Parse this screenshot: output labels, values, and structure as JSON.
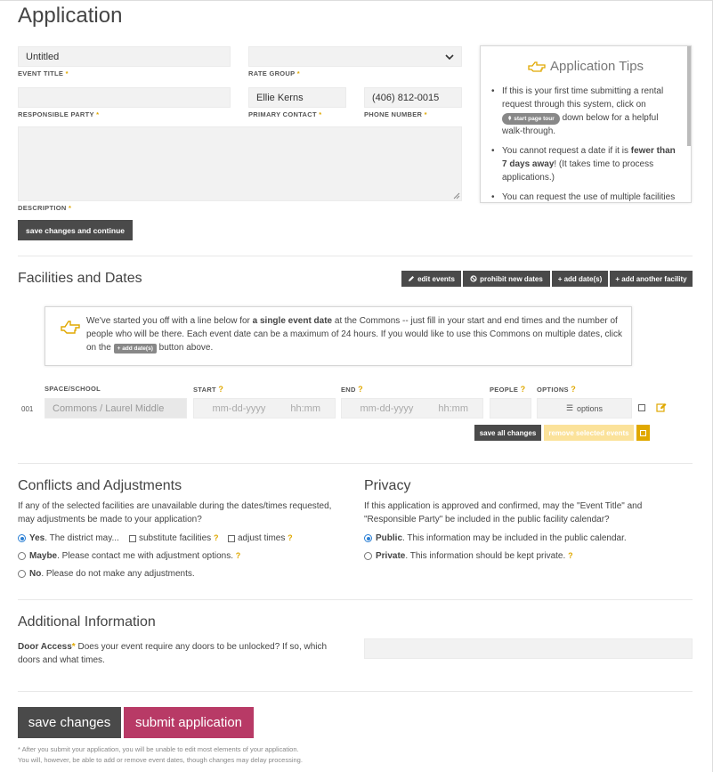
{
  "page": {
    "title": "Application"
  },
  "form": {
    "event_title": {
      "value": "Untitled",
      "label": "EVENT TITLE"
    },
    "rate_group": {
      "value": "",
      "label": "RATE GROUP"
    },
    "responsible_party": {
      "value": "",
      "label": "RESPONSIBLE PARTY"
    },
    "primary_contact": {
      "value": "Ellie Kerns",
      "label": "PRIMARY CONTACT"
    },
    "phone": {
      "value": "(406) 812-0015",
      "label": "PHONE NUMBER"
    },
    "description": {
      "label": "DESCRIPTION"
    },
    "save_continue": "save changes and continue"
  },
  "tips": {
    "title": "Application Tips",
    "t1_a": "If this is your first time submitting a rental request through this system, click on",
    "t1_badge": "start page tour",
    "t1_b": "down below for a helpful walk-through.",
    "t2_a": "You cannot request a date if it is",
    "t2_bold": "fewer than 7 days away",
    "t2_b": "! (It takes time to process applications.)",
    "t3": "You can request the use of multiple facilities"
  },
  "facilities": {
    "title": "Facilities and Dates",
    "buttons": {
      "edit": "edit events",
      "prohibit": "prohibit new dates",
      "add_dates": "+ add date(s)",
      "add_facility": "+ add another facility"
    },
    "notice_a": "We've started you off with a line below for",
    "notice_bold": "a single event date",
    "notice_b": "at the Commons -- just fill in your start and end times and the number of people who will be there. Each event date can be a maximum of 24 hours. If you would like to use this Commons on multiple dates, click on the",
    "notice_badge": "+ add date(s)",
    "notice_c": "button above.",
    "headers": {
      "space": "SPACE/SCHOOL",
      "start": "START",
      "end": "END",
      "people": "PEOPLE",
      "options": "OPTIONS"
    },
    "row": {
      "num": "001",
      "space": "Commons / Laurel Middle",
      "start_date": "mm-dd-yyyy",
      "start_time": "hh:mm",
      "end_date": "mm-dd-yyyy",
      "end_time": "hh:mm",
      "options": "options"
    },
    "save_all": "save all changes",
    "remove_selected": "remove selected events"
  },
  "conflicts": {
    "title": "Conflicts and Adjustments",
    "desc": "If any of the selected facilities are unavailable during the dates/times requested, may adjustments be made to your application?",
    "yes_bold": "Yes",
    "yes_text": ". The district may...",
    "sub_fac": "substitute facilities",
    "adj_times": "adjust times",
    "maybe_bold": "Maybe",
    "maybe_text": ". Please contact me with adjustment options.",
    "no_bold": "No",
    "no_text": ". Please do not make any adjustments."
  },
  "privacy": {
    "title": "Privacy",
    "desc": "If this application is approved and confirmed, may the \"Event Title\" and \"Responsible Party\" be included in the public facility calendar?",
    "public_bold": "Public",
    "public_text": ". This information may be included in the public calendar.",
    "private_bold": "Private",
    "private_text": ". This information should be kept private."
  },
  "additional": {
    "title": "Additional Information",
    "door_bold": "Door Access",
    "door_text": "Does your event require any doors to be unlocked? If so, which doors and what times."
  },
  "footer": {
    "save": "save changes",
    "submit": "submit application",
    "note1": "* After you submit your application, you will be unable to edit most elements of your application.",
    "note2": "You will, however, be able to add or remove event dates, though changes may delay processing."
  },
  "colors": {
    "accent": "#e0a800",
    "dark_button": "#4a4a4a",
    "submit": "#b83a66",
    "radio": "#2a7fd4",
    "remove_button": "#fbe29a"
  },
  "icons": [
    "hand-point-icon",
    "pencil-icon",
    "ban-icon",
    "list-icon",
    "edit-icon",
    "chevron-down-icon"
  ]
}
